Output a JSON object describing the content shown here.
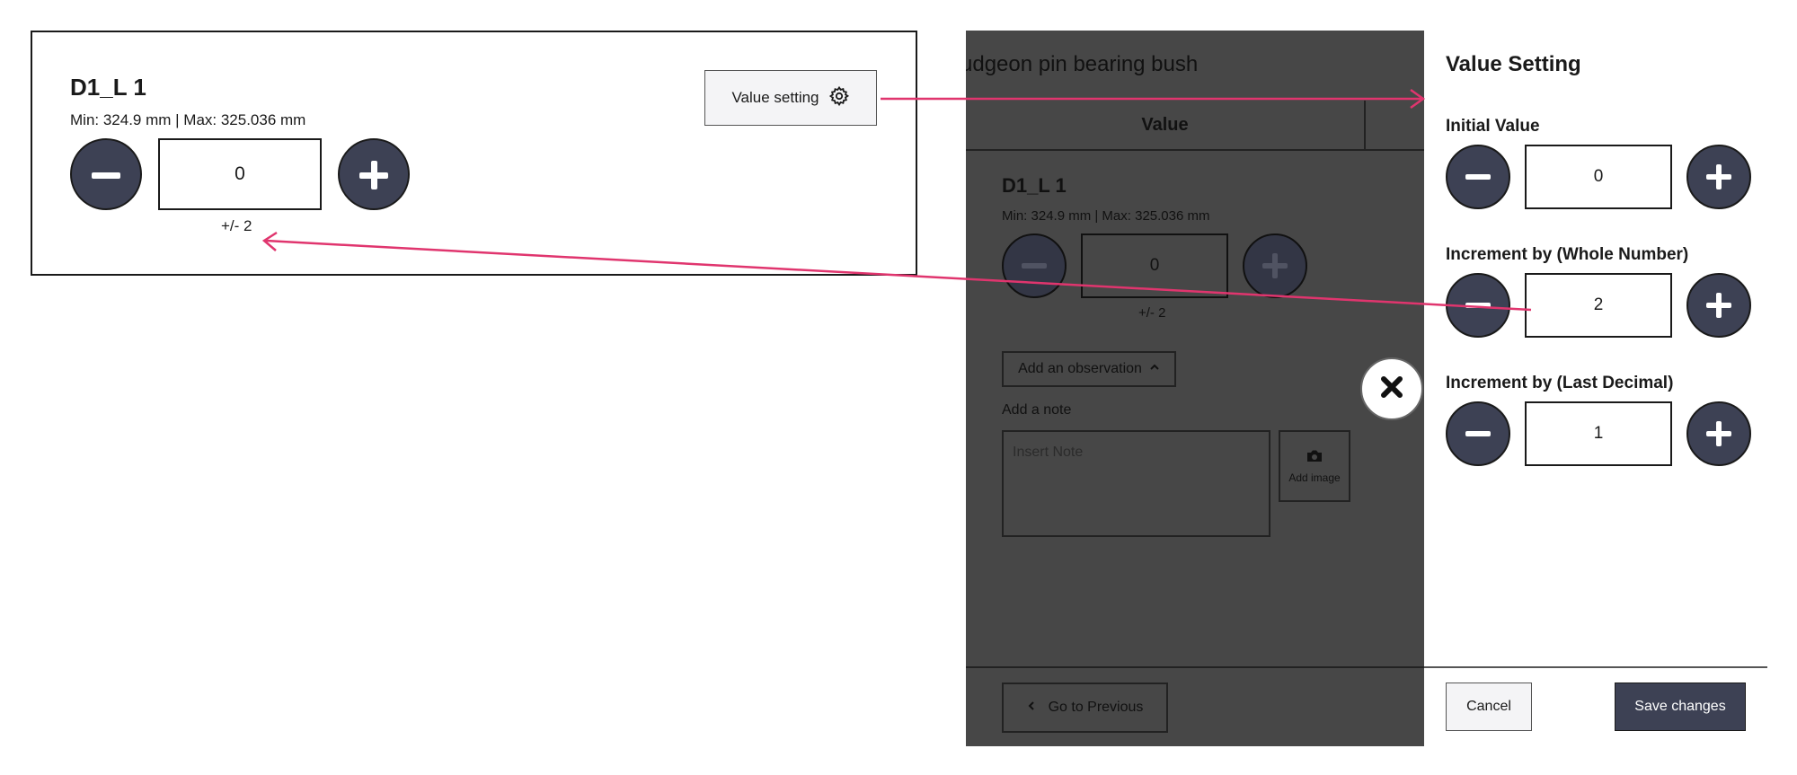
{
  "card": {
    "title": "D1_L 1",
    "range": "Min: 324.9 mm | Max: 325.036 mm",
    "value": "0",
    "tolerance": "+/- 2",
    "value_setting_label": "Value setting"
  },
  "modal": {
    "title": "udgeon pin bearing bush",
    "tab_value": "Value",
    "item_title": "D1_L 1",
    "item_range": "Min: 324.9 mm | Max: 325.036 mm",
    "item_value": "0",
    "item_tolerance": "+/- 2",
    "add_observation_label": "Add an observation",
    "add_note_label": "Add a note",
    "note_placeholder": "Insert Note",
    "add_image_label": "Add image",
    "go_previous_label": "Go to Previous"
  },
  "settings": {
    "title": "Value Setting",
    "initial_label": "Initial Value",
    "initial_value": "0",
    "whole_label": "Increment by (Whole Number)",
    "whole_value": "2",
    "decimal_label": "Increment by (Last Decimal)",
    "decimal_value": "1",
    "cancel_label": "Cancel",
    "save_label": "Save changes"
  },
  "colors": {
    "accent_dark": "#3d4154",
    "overlay": "#474747",
    "arrow": "#e0356e"
  },
  "icons": [
    "gear-icon",
    "minus-icon",
    "plus-icon",
    "chevron-up-icon",
    "camera-icon",
    "chevron-left-icon",
    "close-icon"
  ]
}
